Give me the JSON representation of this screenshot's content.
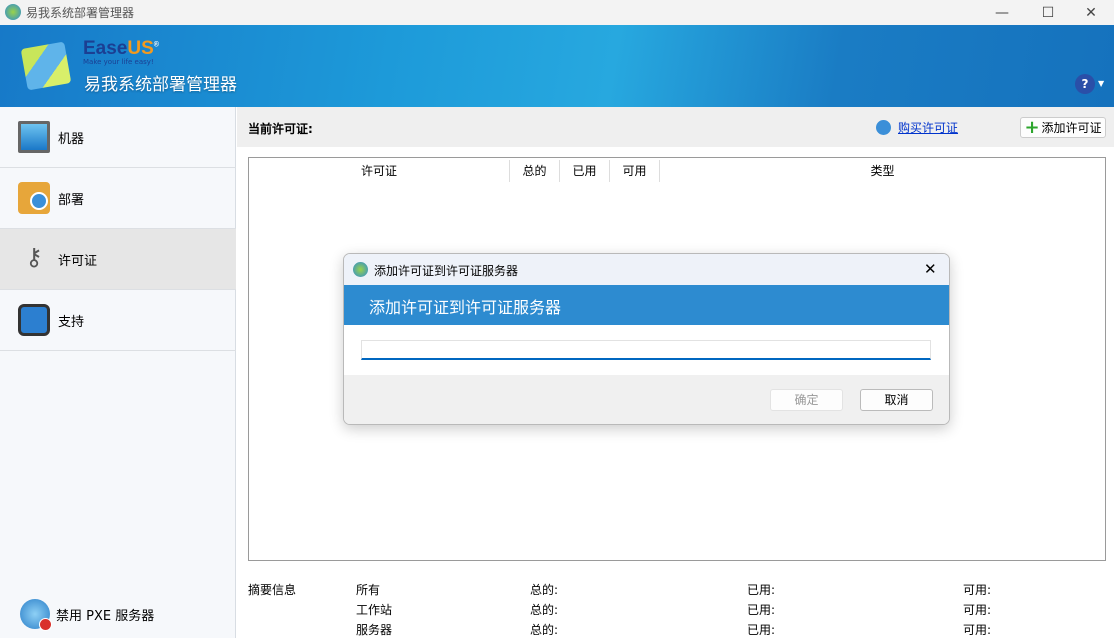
{
  "window": {
    "title": "易我系统部署管理器",
    "minimize": "—",
    "maximize": "☐",
    "close": "✕"
  },
  "banner": {
    "brand_ease": "Ease",
    "brand_us": "US",
    "registered": "®",
    "tagline": "Make your life easy!",
    "title": "易我系统部署管理器",
    "help": "?"
  },
  "sidebar": {
    "items": [
      {
        "label": "机器",
        "icon": "monitor-icon"
      },
      {
        "label": "部署",
        "icon": "deploy-clock-icon"
      },
      {
        "label": "许可证",
        "icon": "keys-icon"
      },
      {
        "label": "支持",
        "icon": "headset-icon"
      }
    ],
    "selected": "许可证",
    "pxe": "禁用 PXE 服务器"
  },
  "main": {
    "current_license": "当前许可证:",
    "buy_link": "购买许可证",
    "add_button": "添加许可证",
    "columns": [
      "许可证",
      "总的",
      "已用",
      "可用",
      "类型"
    ],
    "summary": {
      "label": "摘要信息",
      "rows": [
        {
          "name": "所有",
          "total": "总的:",
          "used": "已用:",
          "avail": "可用:"
        },
        {
          "name": "工作站",
          "total": "总的:",
          "used": "已用:",
          "avail": "可用:"
        },
        {
          "name": "服务器",
          "total": "总的:",
          "used": "已用:",
          "avail": "可用:"
        }
      ]
    }
  },
  "dialog": {
    "title": "添加许可证到许可证服务器",
    "heading": "添加许可证到许可证服务器",
    "input_value": "",
    "ok": "确定",
    "cancel": "取消",
    "close": "✕"
  },
  "colors": {
    "accent": "#2d8bd0",
    "banner": "#1d9ad9"
  }
}
